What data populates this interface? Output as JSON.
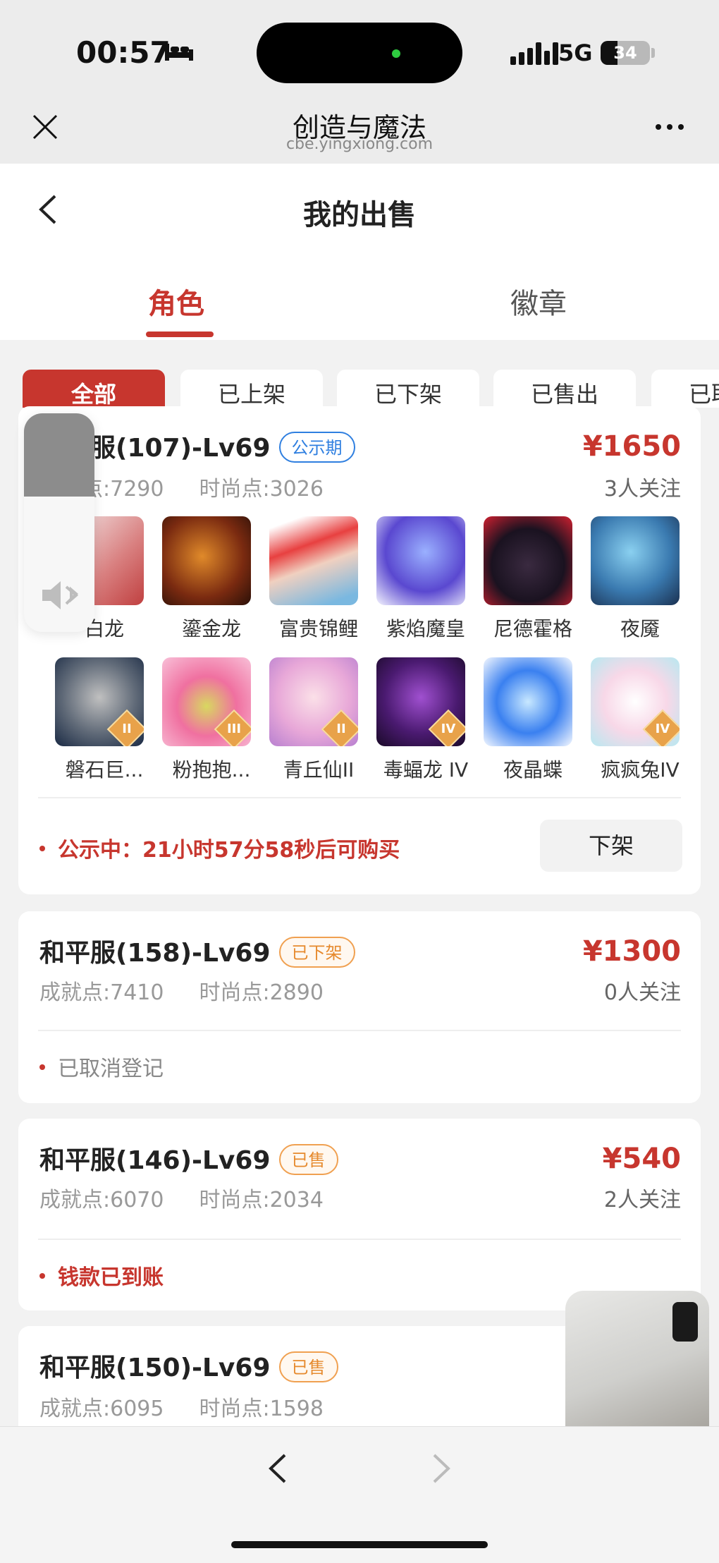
{
  "status_bar": {
    "time": "00:57",
    "network": "5G",
    "battery_level": "34",
    "battery_fraction": 0.34
  },
  "browser": {
    "title": "创造与魔法",
    "url": "cbe.yingxiong.com"
  },
  "page": {
    "title": "我的出售",
    "tabs": [
      "角色",
      "徽章"
    ],
    "active_tab": "角色",
    "accent_color": "#c7362e"
  },
  "filters": [
    "全部",
    "已上架",
    "已下架",
    "已售出",
    "已取消"
  ],
  "cards": [
    {
      "title": "和平服(107)-Lv69",
      "badge": "公示期",
      "price": "¥1650",
      "follow": "3人关注",
      "achievement": "成就点:7290",
      "fashion": "时尚点:3026",
      "pets_row1": [
        {
          "name": "白龙",
          "icon": "dragon-white"
        },
        {
          "name": "鎏金龙",
          "icon": "dragon-gold"
        },
        {
          "name": "富贵锦鲤",
          "icon": "koi-fish"
        },
        {
          "name": "紫焰魔皇",
          "icon": "purple-phoenix"
        },
        {
          "name": "尼德霍格",
          "icon": "black-dragon"
        },
        {
          "name": "夜魇",
          "icon": "night-beast"
        }
      ],
      "pets_row2": [
        {
          "name": "磐石巨...",
          "icon": "rock-giant",
          "tier": "II"
        },
        {
          "name": "粉抱抱...",
          "icon": "pink-bear",
          "tier": "III"
        },
        {
          "name": "青丘仙II",
          "icon": "fox-fairy",
          "tier": "II"
        },
        {
          "name": "毒蝠龙 IV",
          "icon": "poison-bat-dragon",
          "tier": "IV"
        },
        {
          "name": "夜晶蝶",
          "icon": "crystal-butterfly"
        },
        {
          "name": "疯疯兔IV",
          "icon": "crazy-rabbit",
          "tier": "IV"
        }
      ],
      "note": "公示中：21小时57分58秒后可购买",
      "action": "下架"
    },
    {
      "title": "和平服(158)-Lv69",
      "badge": "已下架",
      "price": "¥1300",
      "follow": "0人关注",
      "achievement": "成就点:7410",
      "fashion": "时尚点:2890",
      "note": "已取消登记"
    },
    {
      "title": "和平服(146)-Lv69",
      "badge": "已售",
      "price": "¥540",
      "follow": "2人关注",
      "achievement": "成就点:6070",
      "fashion": "时尚点:2034",
      "note": "钱款已到账"
    },
    {
      "title": "和平服(150)-Lv69",
      "badge": "已售",
      "achievement": "成就点:6095",
      "fashion": "时尚点:1598"
    }
  ],
  "volume": {
    "level": 0.38,
    "icon": "speaker-muted-icon"
  }
}
